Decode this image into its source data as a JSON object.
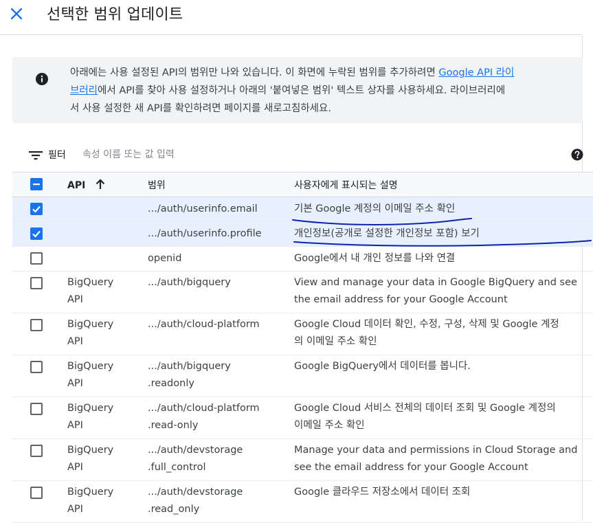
{
  "header": {
    "title": "선택한 범위 업데이트",
    "close_icon": "close-icon"
  },
  "info": {
    "icon": "info-icon",
    "line1_text": "아래에는 사용 설정된 API의 범위만 나와 있습니다. 이 화면에 누락된 범위를 추가하려면 ",
    "line1_link": "Google API 라이",
    "line2_link": "브러리",
    "line2_text": "에서 API를 찾아 사용 설정하거나 아래의 '붙여넣은 범위' 텍스트 상자를 사용하세요. 라이브러리에",
    "line3_text": "서 사용 설정한 새 API를 확인하려면 페이지를 새로고침하세요."
  },
  "filter": {
    "label": "필터",
    "placeholder": "속성 이름 또는 값 입력",
    "icon": "filter-icon",
    "help_icon": "help-icon"
  },
  "table": {
    "headers": {
      "api": "API",
      "scope": "범위",
      "description": "사용자에게 표시되는 설명"
    },
    "sort_icon": "arrow-up-icon",
    "header_checkbox": "indeterminate",
    "rows": [
      {
        "checked": true,
        "api_line1": "",
        "api_line2": "",
        "scope_line1": ".../auth/userinfo.email",
        "scope_line2": "",
        "desc_line1": "기본 Google 계정의 이메일 주소 확인",
        "desc_line2": ""
      },
      {
        "checked": true,
        "api_line1": "",
        "api_line2": "",
        "scope_line1": ".../auth/userinfo.profile",
        "scope_line2": "",
        "desc_line1": "개인정보(공개로 설정한 개인정보 포함) 보기",
        "desc_line2": ""
      },
      {
        "checked": false,
        "api_line1": "",
        "api_line2": "",
        "scope_line1": "openid",
        "scope_line2": "",
        "desc_line1": "Google에서 내 개인 정보를 나와 연결",
        "desc_line2": ""
      },
      {
        "checked": false,
        "api_line1": "BigQuery",
        "api_line2": "API",
        "scope_line1": ".../auth/bigquery",
        "scope_line2": "",
        "desc_line1": "View and manage your data in Google BigQuery and see",
        "desc_line2": "the email address for your Google Account"
      },
      {
        "checked": false,
        "api_line1": "BigQuery",
        "api_line2": "API",
        "scope_line1": ".../auth/cloud-platform",
        "scope_line2": "",
        "desc_line1": "Google Cloud 데이터 확인, 수정, 구성, 삭제 및 Google 계정",
        "desc_line2": "의 이메일 주소 확인"
      },
      {
        "checked": false,
        "api_line1": "BigQuery",
        "api_line2": "API",
        "scope_line1": ".../auth/bigquery",
        "scope_line2": ".readonly",
        "desc_line1": "Google BigQuery에서 데이터를 봅니다.",
        "desc_line2": ""
      },
      {
        "checked": false,
        "api_line1": "BigQuery",
        "api_line2": "API",
        "scope_line1": ".../auth/cloud-platform",
        "scope_line2": ".read-only",
        "desc_line1": "Google Cloud 서비스 전체의 데이터 조회 및 Google 계정의",
        "desc_line2": "이메일 주소 확인"
      },
      {
        "checked": false,
        "api_line1": "BigQuery",
        "api_line2": "API",
        "scope_line1": ".../auth/devstorage",
        "scope_line2": ".full_control",
        "desc_line1": "Manage your data and permissions in Cloud Storage and",
        "desc_line2": "see the email address for your Google Account"
      },
      {
        "checked": false,
        "api_line1": "BigQuery",
        "api_line2": "API",
        "scope_line1": ".../auth/devstorage",
        "scope_line2": ".read_only",
        "desc_line1": "Google 클라우드 저장소에서 데이터 조회",
        "desc_line2": ""
      }
    ]
  },
  "colors": {
    "accent": "#1a73e8",
    "selected_row": "#e8f0fe",
    "info_bg": "#f1f3f4",
    "annotation_ink": "#0b23a8"
  }
}
